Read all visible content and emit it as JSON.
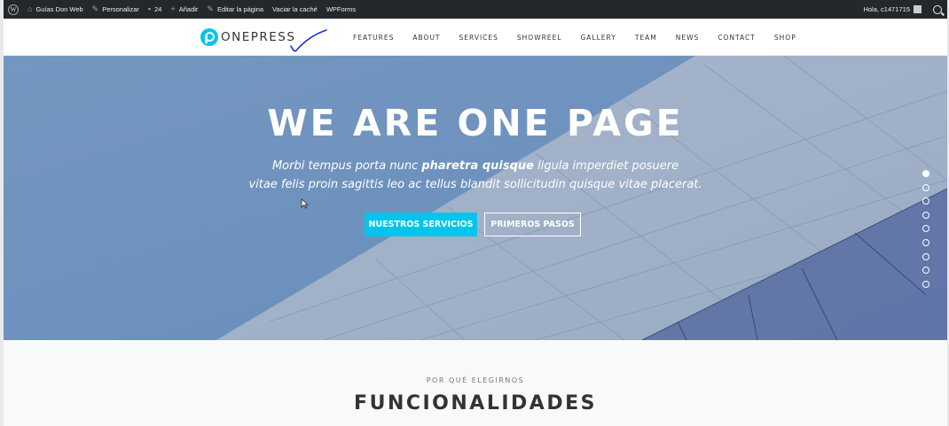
{
  "adminbar": {
    "wp_logo": "W",
    "site_name": "Guías Don Web",
    "customize": "Personalizar",
    "comments_count": "24",
    "add_new": "Añadir",
    "edit_page": "Editar la página",
    "clear_cache": "Vaciar la caché",
    "wpforms": "WPForms",
    "greeting": "Hola, c1471715"
  },
  "header": {
    "logo_text": "ONEPRESS",
    "nav": [
      "FEATURES",
      "ABOUT",
      "SERVICES",
      "SHOWREEL",
      "GALLERY",
      "TEAM",
      "NEWS",
      "CONTACT",
      "SHOP"
    ]
  },
  "hero": {
    "title": "WE ARE ONE PAGE",
    "subtitle_line1_pre": "Morbi tempus porta nunc ",
    "subtitle_line1_bold": "pharetra quisque",
    "subtitle_line1_post": " ligula imperdiet posuere",
    "subtitle_line2": "vitae felis proin sagittis leo ac tellus blandit sollicitudin quisque vitae placerat.",
    "primary_button": "NUESTROS SERVICIOS",
    "secondary_button": "PRIMEROS PASOS",
    "slide_count": 9,
    "active_slide": 1
  },
  "features": {
    "kicker": "POR QUÉ ELEGIRNOS",
    "title": "FUNCIONALIDADES"
  },
  "colors": {
    "accent": "#03c4eb",
    "adminbar": "#23282d"
  }
}
